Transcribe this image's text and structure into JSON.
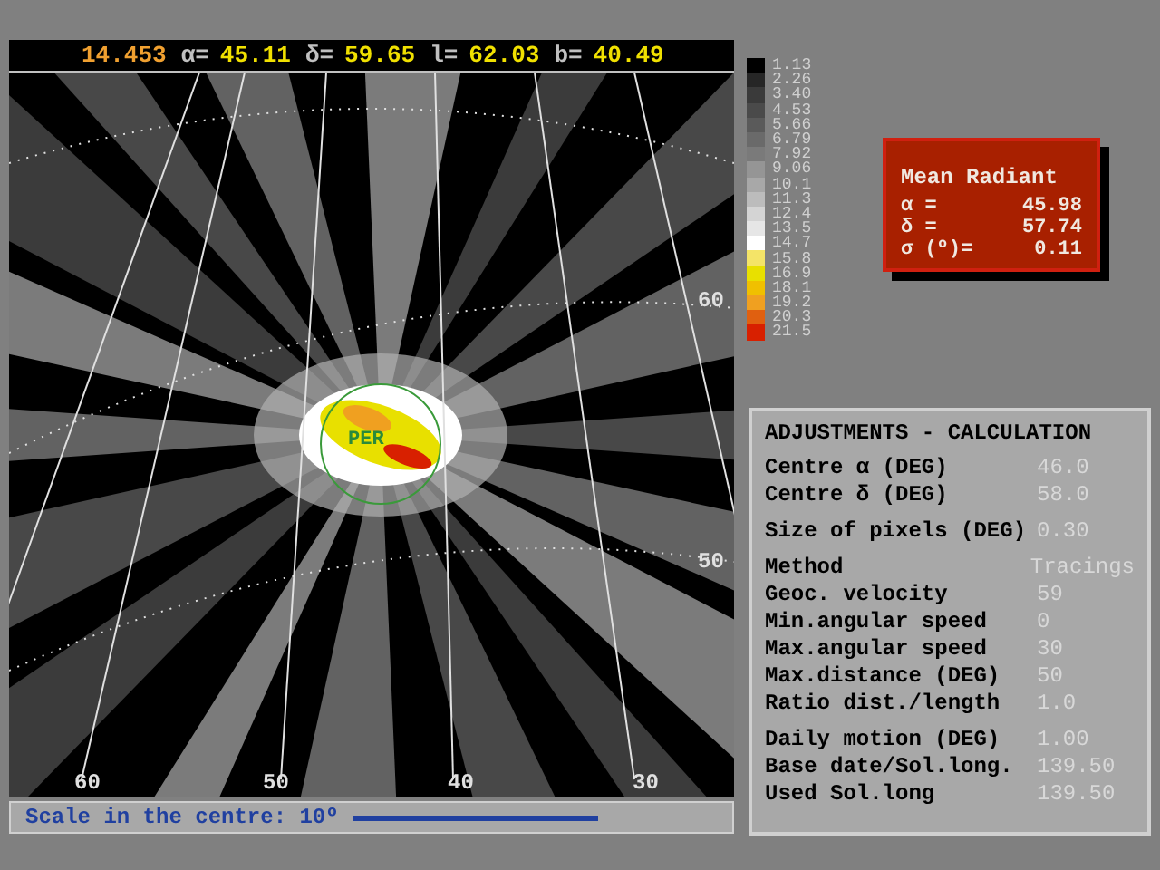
{
  "header": {
    "time": "14.453",
    "fields": [
      {
        "label": "α=",
        "value": "45.11"
      },
      {
        "label": "δ=",
        "value": "59.65"
      },
      {
        "label": "l=",
        "value": "62.03"
      },
      {
        "label": "b=",
        "value": "40.49"
      }
    ]
  },
  "map": {
    "labels": [
      "60",
      "50",
      "60",
      "50",
      "40",
      "30"
    ],
    "shower": "PER"
  },
  "scale": {
    "label": "Scale in the centre: 10º"
  },
  "legend": [
    {
      "value": "1.13",
      "color": "#000000"
    },
    {
      "value": "2.26",
      "color": "#262626"
    },
    {
      "value": "3.40",
      "color": "#3a3a3a"
    },
    {
      "value": "4.53",
      "color": "#4a4a4a"
    },
    {
      "value": "5.66",
      "color": "#5a5a5a"
    },
    {
      "value": "6.79",
      "color": "#6a6a6a"
    },
    {
      "value": "7.92",
      "color": "#7a7a7a"
    },
    {
      "value": "9.06",
      "color": "#959595"
    },
    {
      "value": "10.1",
      "color": "#a8a8a8"
    },
    {
      "value": "11.3",
      "color": "#bcbcbc"
    },
    {
      "value": "12.4",
      "color": "#d4d4d4"
    },
    {
      "value": "13.5",
      "color": "#e6e6e6"
    },
    {
      "value": "14.7",
      "color": "#ffffff"
    },
    {
      "value": "15.8",
      "color": "#f4e468"
    },
    {
      "value": "16.9",
      "color": "#e8e000"
    },
    {
      "value": "18.1",
      "color": "#f0c000"
    },
    {
      "value": "19.2",
      "color": "#f0a020"
    },
    {
      "value": "20.3",
      "color": "#e06010"
    },
    {
      "value": "21.5",
      "color": "#d82000"
    }
  ],
  "mean_radiant": {
    "title": "Mean Radiant",
    "rows": [
      {
        "label": "α =",
        "value": "45.98"
      },
      {
        "label": "δ =",
        "value": "57.74"
      },
      {
        "label": "σ (º)=",
        "value": "0.11"
      }
    ]
  },
  "adjustments": {
    "title": "ADJUSTMENTS - CALCULATION",
    "groups": [
      [
        {
          "label": "Centre α (DEG)",
          "value": "46.0"
        },
        {
          "label": "Centre δ (DEG)",
          "value": "58.0"
        }
      ],
      [
        {
          "label": "Size of pixels (DEG)",
          "value": "0.30"
        }
      ],
      [
        {
          "label": "Method",
          "value": "Tracings"
        },
        {
          "label": "Geoc. velocity",
          "value": "59"
        },
        {
          "label": "Min.angular speed",
          "value": "0"
        },
        {
          "label": "Max.angular speed",
          "value": "30"
        },
        {
          "label": "Max.distance (DEG)",
          "value": "50"
        },
        {
          "label": "Ratio dist./length",
          "value": "1.0"
        }
      ],
      [
        {
          "label": "Daily motion (DEG)",
          "value": "1.00"
        },
        {
          "label": "Base date/Sol.long.",
          "value": "139.50"
        },
        {
          "label": "Used Sol.long",
          "value": "139.50"
        }
      ]
    ]
  }
}
